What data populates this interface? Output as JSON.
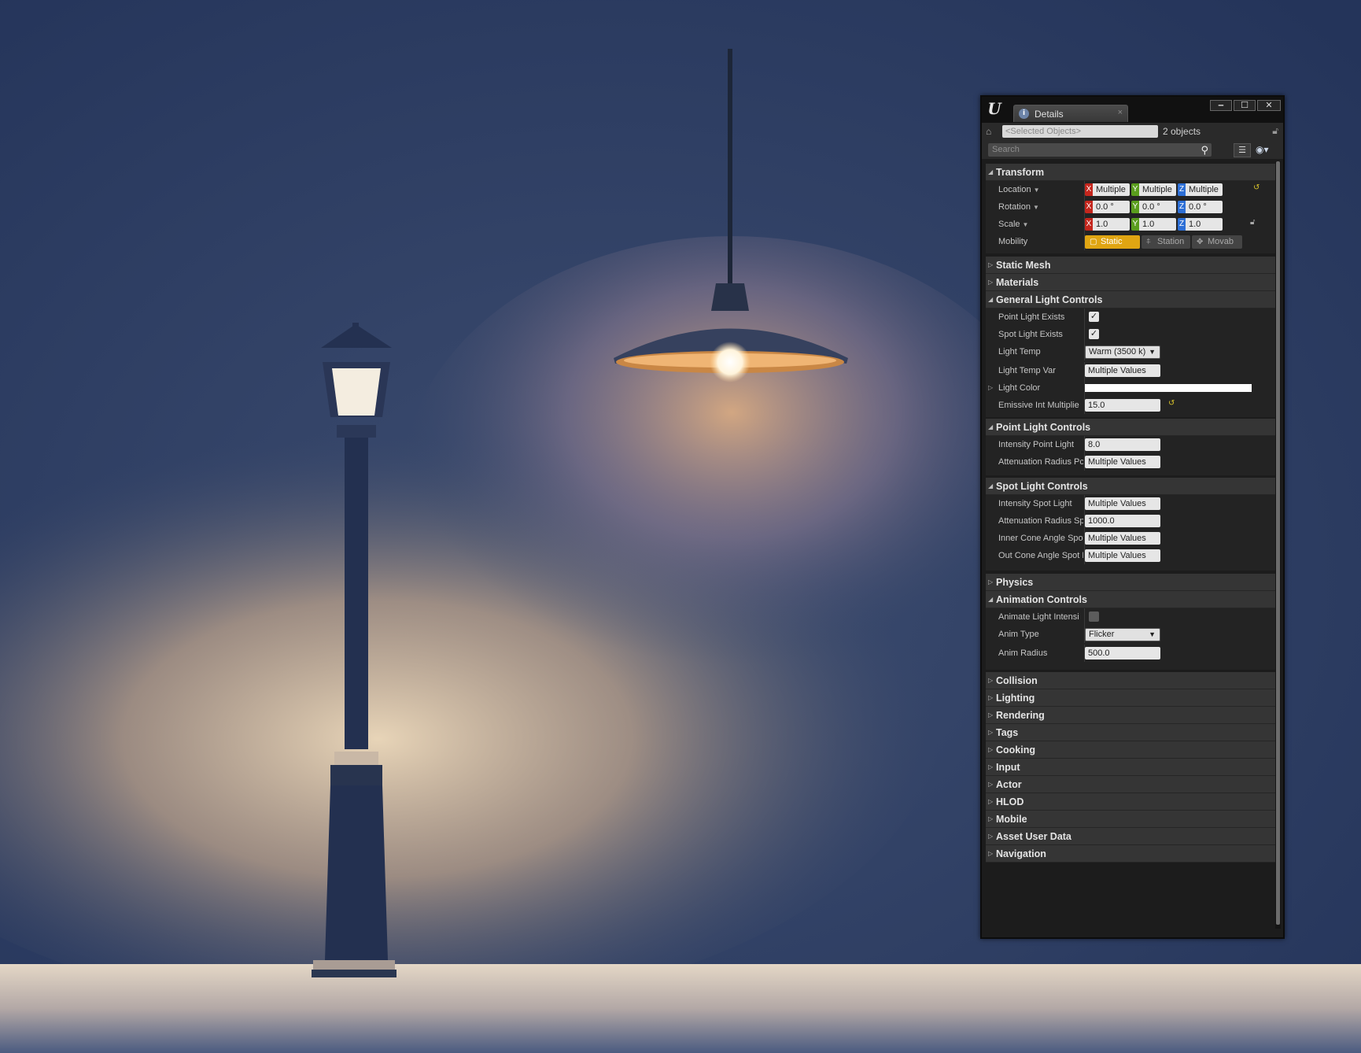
{
  "window": {
    "tab_label": "Details",
    "tab_close": "×",
    "logo": "U",
    "minimize": "‒",
    "maximize": "☐",
    "close": "✕"
  },
  "selection": {
    "selected_placeholder": "<Selected Objects>",
    "count": "2 objects"
  },
  "search": {
    "placeholder": "Search"
  },
  "transform": {
    "title": "Transform",
    "location_label": "Location",
    "rotation_label": "Rotation",
    "scale_label": "Scale",
    "mobility_label": "Mobility",
    "axis_x": "X",
    "axis_y": "Y",
    "axis_z": "Z",
    "location": [
      "Multiple",
      "Multiple",
      "Multiple"
    ],
    "rotation": [
      "0.0 °",
      "0.0 °",
      "0.0 °"
    ],
    "scale": [
      "1.0",
      "1.0",
      "1.0"
    ],
    "mobility_options": [
      "Static",
      "Station",
      "Movab"
    ],
    "mobility_selected": "Static"
  },
  "collapsed_top": [
    "Static Mesh",
    "Materials"
  ],
  "general_light": {
    "title": "General Light Controls",
    "point_light_exists_label": "Point Light Exists",
    "point_light_exists": true,
    "spot_light_exists_label": "Spot Light Exists",
    "spot_light_exists": true,
    "light_temp_label": "Light Temp",
    "light_temp": "Warm (3500 k)",
    "light_temp_var_label": "Light Temp Var",
    "light_temp_var": "Multiple Values",
    "light_color_label": "Light Color",
    "light_color": "#ffffff",
    "emissive_label": "Emissive Int Multiplie",
    "emissive": "15.0"
  },
  "point_light": {
    "title": "Point Light Controls",
    "intensity_label": "Intensity Point Light",
    "intensity": "8.0",
    "atten_label": "Attenuation Radius Pc",
    "atten": "Multiple Values"
  },
  "spot_light": {
    "title": "Spot Light Controls",
    "intensity_label": "Intensity Spot Light",
    "intensity": "Multiple Values",
    "atten_label": "Attenuation Radius Sp",
    "atten": "1000.0",
    "inner_label": "Inner Cone Angle Spot",
    "inner": "Multiple Values",
    "outer_label": "Out Cone Angle Spot L",
    "outer": "Multiple Values"
  },
  "physics": {
    "title": "Physics"
  },
  "animation": {
    "title": "Animation Controls",
    "animate_label": "Animate Light Intensi",
    "animate": false,
    "anim_type_label": "Anim Type",
    "anim_type": "Flicker",
    "anim_radius_label": "Anim Radius",
    "anim_radius": "500.0"
  },
  "collapsed_bottom": [
    "Collision",
    "Lighting",
    "Rendering",
    "Tags",
    "Cooking",
    "Input",
    "Actor",
    "HLOD",
    "Mobile",
    "Asset User Data",
    "Navigation"
  ],
  "colors": {
    "accent_static": "#e0a512",
    "axis_x": "#c4261d",
    "axis_y": "#5a9d1d",
    "axis_z": "#2d6fd6",
    "panel_bg": "#1c1c1c"
  },
  "icons": [
    "ue-logo-icon",
    "details-tab-icon",
    "home-icon",
    "lock-icon",
    "search-icon",
    "grid-view-icon",
    "eye-icon",
    "reset-arrow-icon"
  ]
}
